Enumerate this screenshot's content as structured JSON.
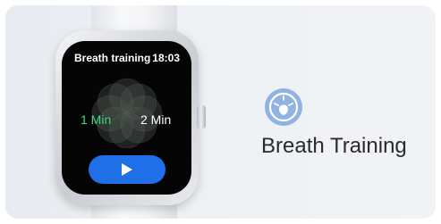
{
  "watch": {
    "screen_title": "Breath training",
    "clock": "18:03",
    "options": [
      "1 Min",
      "2 Min"
    ],
    "selected_option": "1 Min",
    "play_icon": "play-icon"
  },
  "feature": {
    "icon": "breath-training-icon",
    "title": "Breath Training"
  },
  "colors": {
    "selected_option": "#3ddc84",
    "play_button": "#1f6fe8",
    "feature_icon": "#8fb4e3",
    "screen": "#050505"
  }
}
